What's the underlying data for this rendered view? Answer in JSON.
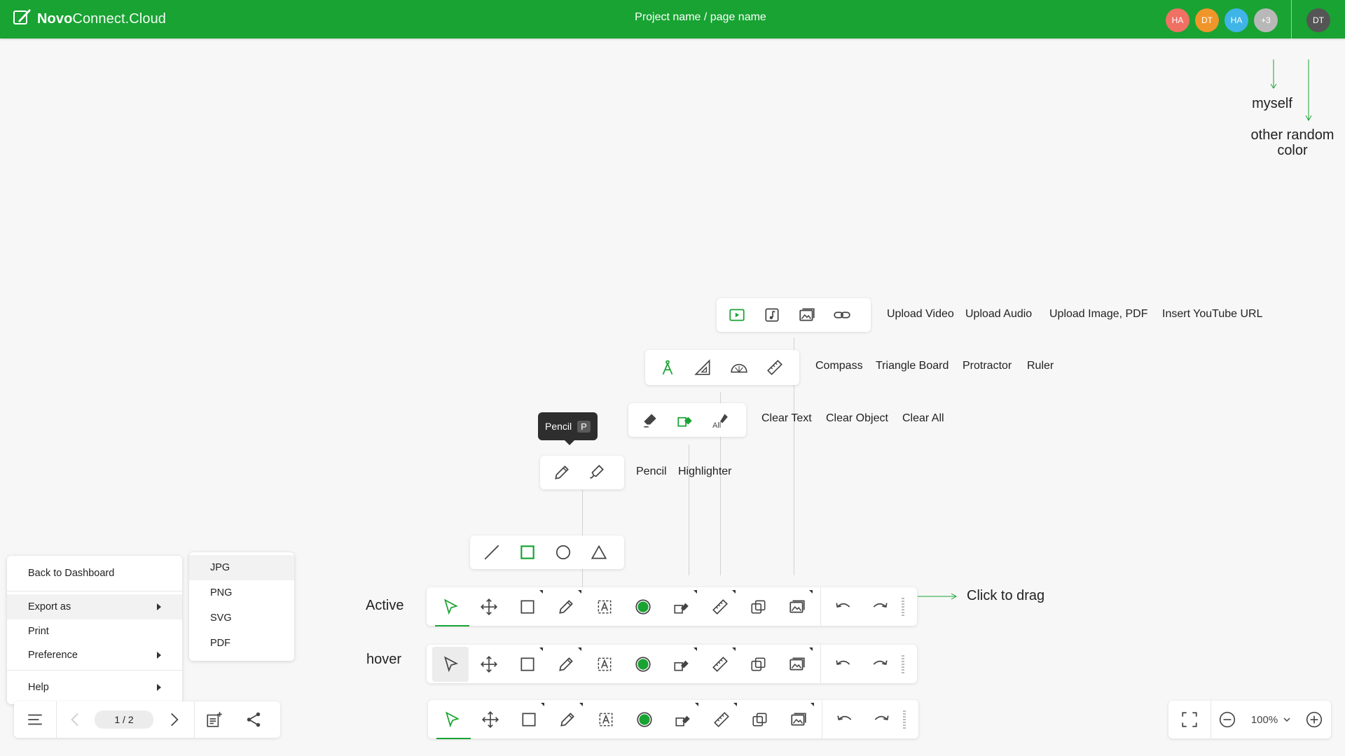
{
  "app": {
    "brand_bold": "Novo",
    "brand_light": "Connect.Cloud",
    "page_title": "Project name / page name"
  },
  "collaborators": [
    {
      "initials": "HA",
      "color": "#f07064"
    },
    {
      "initials": "DT",
      "color": "#f0952a"
    },
    {
      "initials": "HA",
      "color": "#3fb4e6"
    },
    {
      "initials": "+3",
      "color": "#b8b8b8"
    }
  ],
  "self_avatar": {
    "initials": "DT",
    "color": "#555555"
  },
  "annotations": {
    "myself": "myself",
    "other_color": "other random color",
    "click_to_drag": "Click to drag"
  },
  "media_menu": {
    "upload_video": "Upload Video",
    "upload_audio": "Upload Audio",
    "upload_image": "Upload Image, PDF",
    "youtube": "Insert YouTube URL"
  },
  "measure_menu": {
    "compass": "Compass",
    "triangle": "Triangle Board",
    "protractor": "Protractor",
    "ruler": "Ruler"
  },
  "eraser_menu": {
    "clear_text": "Clear Text",
    "clear_object": "Clear Object",
    "clear_all": "Clear All"
  },
  "pen_menu": {
    "pencil": "Pencil",
    "highlighter": "Highlighter"
  },
  "tooltip": {
    "label": "Pencil",
    "shortcut": "P"
  },
  "state_labels": {
    "active": "Active",
    "hover": "hover"
  },
  "main_menu": {
    "back": "Back to Dashboard",
    "export": "Export as",
    "print": "Print",
    "preference": "Preference",
    "help": "Help"
  },
  "export_menu": {
    "jpg": "JPG",
    "png": "PNG",
    "svg": "SVG",
    "pdf": "PDF"
  },
  "pager": {
    "value": "1 / 2"
  },
  "zoom": {
    "value": "100%"
  },
  "colors": {
    "accent": "#18a332"
  }
}
